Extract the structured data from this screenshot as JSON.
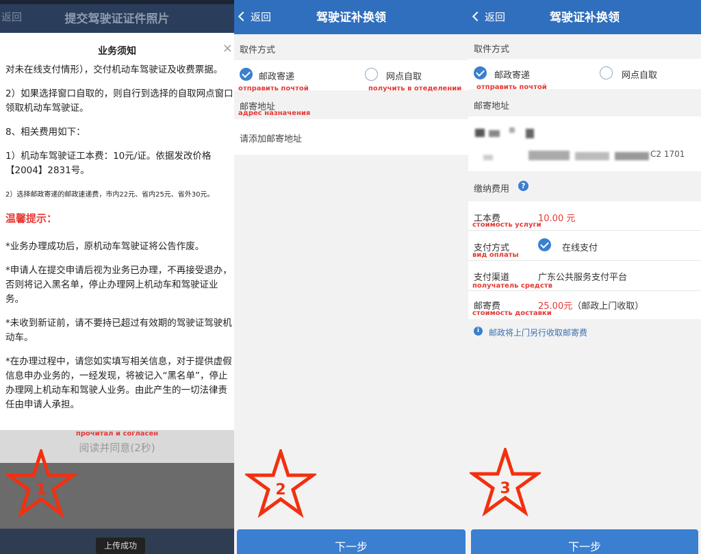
{
  "panel1": {
    "header_back": "返回",
    "header_title": "提交驾驶证证件照片",
    "modal_title": "业务须知",
    "close_glyph": "×",
    "paragraphs": [
      "对未在线支付情形），交付机动车驾驶证及收费票据。",
      "2）如果选择窗口自取的，则自行到选择的自取网点窗口领取机动车驾驶证。",
      "8、相关费用如下：",
      "1）机动车驾驶证工本费：10元/证。依据发改价格【2004】2831号。"
    ],
    "small_paragraph": "2）选择邮政寄递的邮政速递费，市内22元、省内25元、省外30元。",
    "warning_title": "温馨提示：",
    "tips": [
      "*业务办理成功后，原机动车驾驶证将公告作废。",
      "*申请人在提交申请后视为业务已办理，不再接受退办，否则将记入黑名单，停止办理网上机动车和驾驶证业务。",
      "*未收到新证前，请不要持已超过有效期的驾驶证驾驶机动车。",
      "*在办理过程中，请您如实填写相关信息，对于提供虚假信息申办业务的，一经发现，将被记入“黑名单”，停止办理网上机动车和驾驶人业务。由此产生的一切法律责任由申请人承担。"
    ],
    "agree_note": "прочитал и согласен",
    "agree_button": "阅读并同意(2秒)",
    "star_number": "1",
    "toast": "上传成功"
  },
  "panel2": {
    "header_back": "返回",
    "header_title": "驾驶证补换领",
    "pickup_label": "取件方式",
    "option_post": "邮政寄递",
    "option_post_ru": "отправить почтой",
    "option_branch": "网点自取",
    "option_branch_ru": "получить в отеделении",
    "address_label": "邮寄地址",
    "address_ru": "адрес назначения",
    "address_placeholder": "请添加邮寄地址",
    "star_number": "2",
    "next_button": "下一步"
  },
  "panel3": {
    "header_back": "返回",
    "header_title": "驾驶证补换领",
    "pickup_label": "取件方式",
    "option_post": "邮政寄递",
    "option_post_ru": "отправить почтой",
    "option_branch": "网点自取",
    "address_label": "邮寄地址",
    "address_fragment": "C2 1701",
    "fees_label": "缴纳费用",
    "help_glyph": "?",
    "fees": {
      "cost_label": "工本费",
      "cost_value": "10.00 元",
      "cost_ru": "стоимость услуги",
      "pay_method_label": "支付方式",
      "pay_method_value": "在线支付",
      "pay_method_ru": "вид оплаты",
      "channel_label": "支付渠道",
      "channel_value": "广东公共服务支付平台",
      "channel_ru": "получатель средств",
      "postage_label": "邮寄费",
      "postage_value": "25.00元",
      "postage_note": "（邮政上门收取）",
      "postage_ru": "стоимость доставки"
    },
    "info_glyph": "i",
    "info_note": "邮政将上门另行收取邮寄费",
    "star_number": "3",
    "next_button": "下一步"
  },
  "colors": {
    "header_blue": "#2f6fbd",
    "accent_blue": "#3a7fd0",
    "annotation_red": "#e53935",
    "star_red": "#f2300f"
  }
}
